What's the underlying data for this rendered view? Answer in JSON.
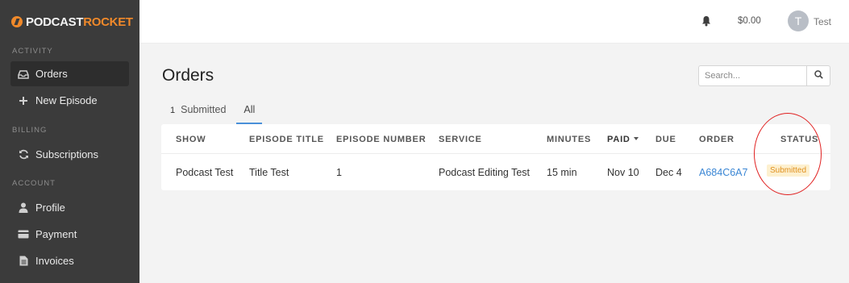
{
  "brand": {
    "part1": "PODCAST",
    "part2": "ROCKET",
    "accent": "#f0892a"
  },
  "sidebar": {
    "sections": [
      {
        "label": "ACTIVITY",
        "items": [
          {
            "label": "Orders",
            "icon": "inbox-icon",
            "active": true
          },
          {
            "label": "New Episode",
            "icon": "plus-icon"
          }
        ]
      },
      {
        "label": "BILLING",
        "items": [
          {
            "label": "Subscriptions",
            "icon": "refresh-icon"
          }
        ]
      },
      {
        "label": "ACCOUNT",
        "items": [
          {
            "label": "Profile",
            "icon": "user-icon"
          },
          {
            "label": "Payment",
            "icon": "credit-card-icon"
          },
          {
            "label": "Invoices",
            "icon": "document-icon"
          }
        ]
      }
    ]
  },
  "topbar": {
    "balance": "$0.00",
    "avatar_initial": "T",
    "username": "Test"
  },
  "main": {
    "title": "Orders",
    "search_placeholder": "Search...",
    "tabs": [
      {
        "count": "1",
        "label": "Submitted"
      },
      {
        "label": "All",
        "active": true
      }
    ],
    "table": {
      "headers": [
        "SHOW",
        "EPISODE TITLE",
        "EPISODE NUMBER",
        "SERVICE",
        "MINUTES",
        "PAID",
        "DUE",
        "ORDER",
        "STATUS"
      ],
      "rows": [
        {
          "show": "Podcast Test",
          "episode_title": "Title Test",
          "episode_number": "1",
          "service": "Podcast Editing Test",
          "minutes": "15 min",
          "paid": "Nov 10",
          "due": "Dec 4",
          "order": "A684C6A7",
          "status": "Submitted"
        }
      ]
    }
  },
  "colors": {
    "sidebar_bg": "#3b3b3b",
    "link": "#3a86d4",
    "status_bg": "#fdf0cf",
    "status_text": "#e0901e",
    "annotation": "#e02020"
  }
}
